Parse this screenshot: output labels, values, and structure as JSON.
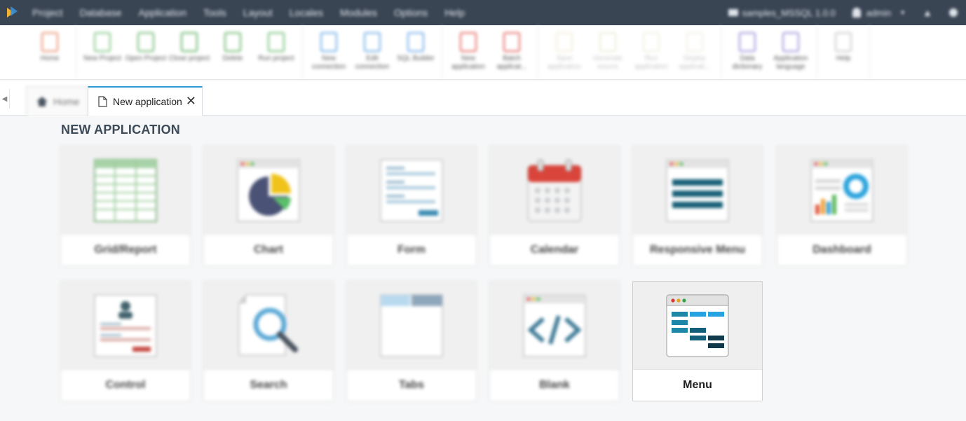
{
  "menubar": {
    "items": [
      "Project",
      "Database",
      "Application",
      "Tools",
      "Layout",
      "Locales",
      "Modules",
      "Options",
      "Help"
    ],
    "project_name": "samples_MSSQL 1.0.0",
    "user": "admin"
  },
  "toolbar": {
    "groups": [
      [
        {
          "label": "Home",
          "color": "#e98c6a"
        }
      ],
      [
        {
          "label": "New Project",
          "color": "#7cc47f"
        },
        {
          "label": "Open Project",
          "color": "#6cb86f"
        },
        {
          "label": "Close project",
          "color": "#5eb062"
        },
        {
          "label": "Delete",
          "color": "#63b567"
        },
        {
          "label": "Run project",
          "color": "#6fbd72"
        }
      ],
      [
        {
          "label": "New connection",
          "color": "#6aa9e6"
        },
        {
          "label": "Edit connection",
          "color": "#6aa9e6"
        },
        {
          "label": "SQL Builder",
          "color": "#6aa9e6"
        }
      ],
      [
        {
          "label": "New application",
          "color": "#e2625c"
        },
        {
          "label": "Batch applicat...",
          "color": "#e2625c"
        }
      ],
      [
        {
          "label": "Save application",
          "color": "#d9c88a",
          "disabled": true
        },
        {
          "label": "Generate source",
          "color": "#c9c07e",
          "disabled": true
        },
        {
          "label": "Run application",
          "color": "#cfd1a0",
          "disabled": true
        },
        {
          "label": "Deploy applicati...",
          "color": "#d6cfaa",
          "disabled": true
        }
      ],
      [
        {
          "label": "Data dictionary",
          "color": "#9a8fd8"
        },
        {
          "label": "Application language",
          "color": "#9a8fd8"
        }
      ],
      [
        {
          "label": "Help",
          "color": "#c8c8c8"
        }
      ]
    ]
  },
  "tabs": {
    "home": "Home",
    "active": "New application"
  },
  "page_title": "NEW APPLICATION",
  "cards": [
    {
      "label": "Grid/Report",
      "icon": "grid-report-icon"
    },
    {
      "label": "Chart",
      "icon": "chart-icon"
    },
    {
      "label": "Form",
      "icon": "form-icon"
    },
    {
      "label": "Calendar",
      "icon": "calendar-icon"
    },
    {
      "label": "Responsive Menu",
      "icon": "responsive-menu-icon"
    },
    {
      "label": "Dashboard",
      "icon": "dashboard-icon"
    },
    {
      "label": "Control",
      "icon": "control-icon"
    },
    {
      "label": "Search",
      "icon": "search-icon"
    },
    {
      "label": "Tabs",
      "icon": "tabs-icon"
    },
    {
      "label": "Blank",
      "icon": "blank-code-icon"
    },
    {
      "label": "Menu",
      "icon": "menu-icon"
    }
  ],
  "colors": {
    "menubar_bg": "#3a4554",
    "accent": "#2b9ad6",
    "menu_teal": "#1e87a8",
    "menu_blue": "#26a3e0"
  }
}
